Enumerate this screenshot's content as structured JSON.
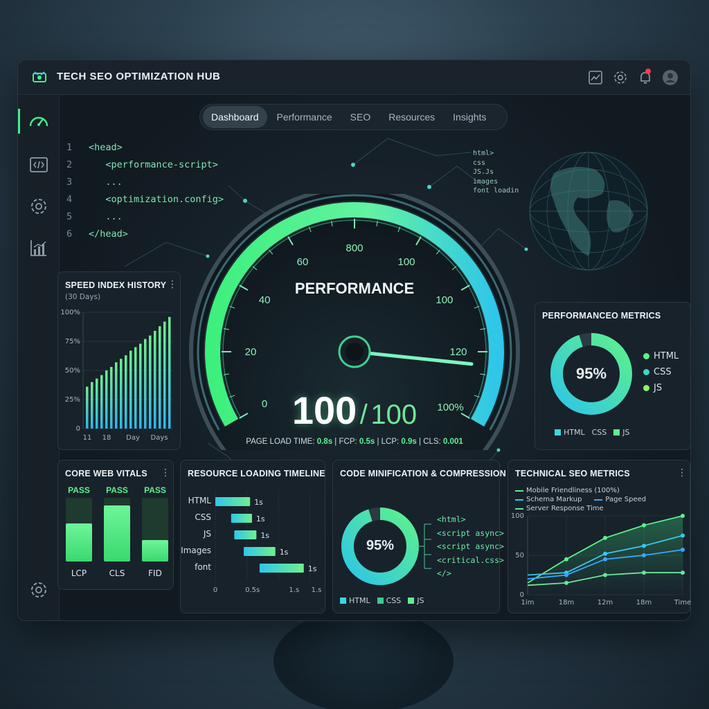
{
  "app": {
    "title": "TECH SEO OPTIMIZATION HUB"
  },
  "toolbar": {
    "icons": [
      "chart-icon",
      "gear-icon",
      "bell-icon",
      "avatar"
    ]
  },
  "sidebar": {
    "items": [
      "speedometer-icon",
      "code-icon",
      "gear-icon",
      "chart-icon"
    ],
    "bottom": "gear-icon"
  },
  "tabs": [
    {
      "label": "Dashboard",
      "active": true
    },
    {
      "label": "Performance",
      "active": false
    },
    {
      "label": "SEO",
      "active": false
    },
    {
      "label": "Resources",
      "active": false
    },
    {
      "label": "Insights",
      "active": false
    }
  ],
  "code": [
    {
      "num": "1",
      "text": "<head>"
    },
    {
      "num": "2",
      "text": "   <performance-script>"
    },
    {
      "num": "3",
      "text": "   ..."
    },
    {
      "num": "4",
      "text": "   <optimization.config>"
    },
    {
      "num": "5",
      "text": "   ..."
    },
    {
      "num": "6",
      "text": "</head>"
    }
  ],
  "resource_list": [
    "html>",
    "css",
    "JS.Js",
    "images",
    "font loadin"
  ],
  "gauge": {
    "title": "PERFORMANCE",
    "score": "100",
    "slash": "/",
    "total": "100",
    "ticks": [
      "0",
      "20",
      "40",
      "60",
      "800",
      "100",
      "100",
      "120",
      "100%"
    ],
    "needle_fraction": 0.9,
    "metrics": {
      "load_label": "PAGE LOAD TIME: ",
      "load": "0.8s",
      "fcp_label": " | FCP: ",
      "fcp": "0.5s",
      "lcp_label": " | LCP: ",
      "lcp": "0.9s",
      "cls_label": " | CLS: ",
      "cls": "0.001"
    }
  },
  "speed_history": {
    "title": "SPEED INDEX HISTORY",
    "subtitle": "(30 Days)",
    "chart_data": {
      "type": "bar",
      "values": [
        36,
        40,
        43,
        46,
        50,
        53,
        57,
        60,
        63,
        67,
        70,
        73,
        77,
        80,
        84,
        88,
        92,
        96
      ],
      "yticks": [
        "100%",
        "75%",
        "50%",
        "25%",
        "0"
      ],
      "xticks": [
        "11",
        "18",
        "Day",
        "Days"
      ],
      "ylim": [
        0,
        100
      ]
    }
  },
  "perf_metrics": {
    "title": "PERFORMANCEO METRICS",
    "center": "95%",
    "percent": 95,
    "legend": [
      "HTML",
      "CSS",
      "JS"
    ],
    "legend_bottom": [
      "HTML",
      "CSS",
      "JS"
    ]
  },
  "web_vitals": {
    "title": "CORE WEB VITALS",
    "items": [
      {
        "status": "PASS",
        "label": "LCP",
        "fill": 0.6
      },
      {
        "status": "PASS",
        "label": "CLS",
        "fill": 0.88
      },
      {
        "status": "PASS",
        "label": "FID",
        "fill": 0.34
      }
    ]
  },
  "timeline": {
    "title": "RESOURCE LOADING TIMELINE",
    "chart_data": {
      "type": "bar",
      "rows": [
        {
          "label": "HTML",
          "start": 0.0,
          "end": 0.55,
          "value": "1s"
        },
        {
          "label": "CSS",
          "start": 0.25,
          "end": 0.58,
          "value": "1s"
        },
        {
          "label": "JS",
          "start": 0.3,
          "end": 0.65,
          "value": "1s"
        },
        {
          "label": "Images",
          "start": 0.45,
          "end": 0.95,
          "value": "1s"
        },
        {
          "label": "font",
          "start": 0.7,
          "end": 1.4,
          "value": "1s"
        }
      ],
      "xticks": [
        "0",
        "0.5s",
        "1.s",
        "1.s"
      ]
    }
  },
  "minification": {
    "title": "CODE MINIFICATION & COMPRESSION",
    "center": "95%",
    "percent": 95,
    "code": [
      "<html>",
      "<script async>",
      "<script async>",
      "<critical.css>",
      "</>"
    ],
    "legend": [
      "HTML",
      "CSS",
      "JS"
    ]
  },
  "tech_seo": {
    "title": "TECHNICAL SEO METRICS",
    "legend": [
      "Mobile Friendliness (100%)",
      "Schema Markup",
      "Page Speed",
      "Server Response Time"
    ],
    "chart_data": {
      "type": "line",
      "x": [
        "1im",
        "18m",
        "12m",
        "18m",
        "Time"
      ],
      "ylim": [
        0,
        100
      ],
      "yticks": [
        "100",
        "50",
        "0"
      ],
      "series": [
        {
          "name": "Mobile Friendliness (100%)",
          "color": "#5ef08c",
          "values": [
            15,
            45,
            72,
            88,
            100
          ]
        },
        {
          "name": "Schema Markup",
          "color": "#38c8f0",
          "values": [
            25,
            28,
            52,
            62,
            75
          ]
        },
        {
          "name": "Page Speed",
          "color": "#3aa6ff",
          "values": [
            20,
            25,
            45,
            50,
            57
          ]
        },
        {
          "name": "Server Response Time",
          "color": "#6fe39a",
          "values": [
            12,
            15,
            25,
            28,
            28
          ]
        }
      ]
    }
  }
}
